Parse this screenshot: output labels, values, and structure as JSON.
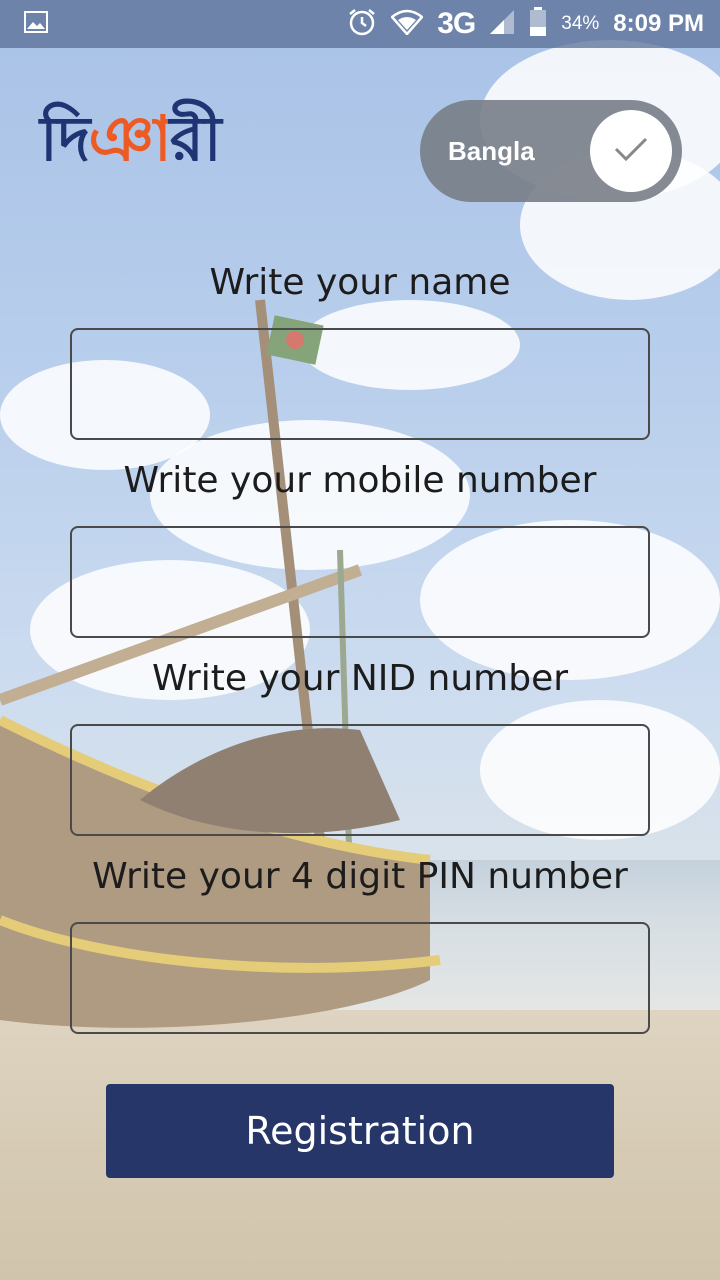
{
  "status_bar": {
    "network": "3G",
    "battery_percent": "34%",
    "time": "8:09 PM",
    "icons": [
      "image-icon",
      "alarm-icon",
      "wifi-icon",
      "signal-icon",
      "battery-icon"
    ]
  },
  "header": {
    "logo_text_part1": "দি",
    "logo_text_part2": "ঞ",
    "logo_text_part3": "ারী",
    "language_toggle": {
      "label": "Bangla",
      "checked": true
    }
  },
  "form": {
    "fields": [
      {
        "label": "Write your name",
        "value": "",
        "placeholder": ""
      },
      {
        "label": "Write your mobile number",
        "value": "",
        "placeholder": ""
      },
      {
        "label": "Write your NID number",
        "value": "",
        "placeholder": ""
      },
      {
        "label": "Write your 4 digit PIN number",
        "value": "",
        "placeholder": ""
      }
    ],
    "submit_label": "Registration"
  },
  "colors": {
    "brand_navy": "#263669",
    "logo_navy": "#1e3473",
    "logo_accent": "#ee5a24"
  }
}
